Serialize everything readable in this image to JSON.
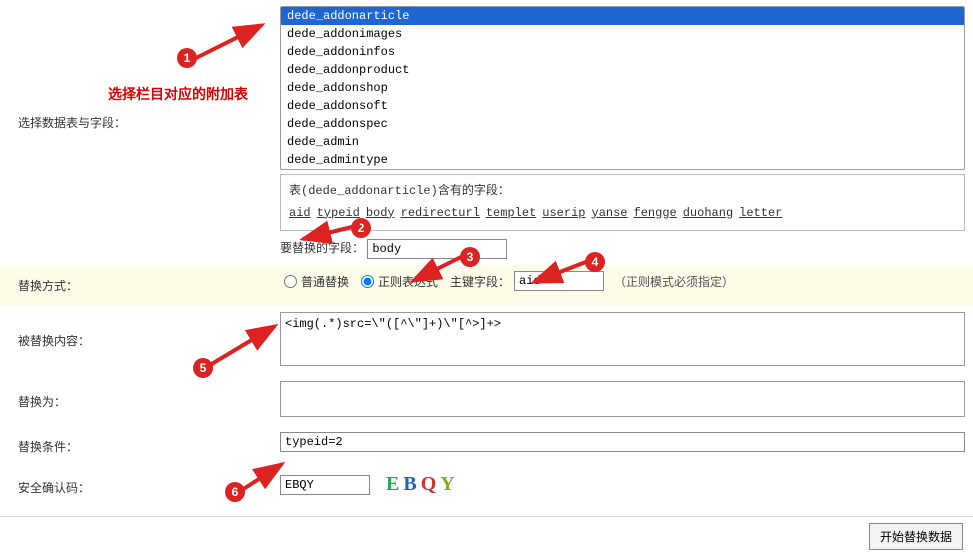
{
  "labels": {
    "select_table": "选择数据表与字段：",
    "mode": "替换方式：",
    "replaced": "被替换内容：",
    "replace_to": "替换为：",
    "condition": "替换条件：",
    "captcha": "安全确认码："
  },
  "tables": {
    "options": [
      "dede_addonarticle",
      "dede_addonimages",
      "dede_addoninfos",
      "dede_addonproduct",
      "dede_addonshop",
      "dede_addonsoft",
      "dede_addonspec",
      "dede_admin",
      "dede_admintype"
    ],
    "selected": "dede_addonarticle"
  },
  "fields": {
    "caption": "表(dede_addonarticle)含有的字段：",
    "list": [
      "aid",
      "typeid",
      "body",
      "redirecturl",
      "templet",
      "userip",
      "yanse",
      "fengge",
      "duohang",
      "letter"
    ]
  },
  "field_to_replace": {
    "label": "要替换的字段：",
    "value": "body"
  },
  "mode": {
    "normal": "普通替换",
    "regex": "正则表达式",
    "pk_label": "主键字段：",
    "pk_value": "aid",
    "hint": "（正则模式必须指定）"
  },
  "textareas": {
    "replaced": "<img(.*)src=\\\"([^\\\"]+)\\\"[^>]+>",
    "replace_to": ""
  },
  "condition": {
    "value": "typeid=2"
  },
  "captcha": {
    "value": "EBQY",
    "image": "EBQY"
  },
  "submit": "开始替换数据",
  "annotation": {
    "text": "选择栏目对应的附加表",
    "numbers": [
      "1",
      "2",
      "3",
      "4",
      "5",
      "6"
    ]
  }
}
